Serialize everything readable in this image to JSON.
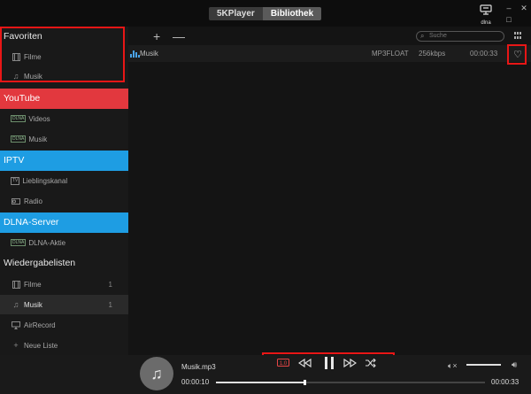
{
  "window": {
    "tabs": [
      "5KPlayer",
      "Bibliothek"
    ],
    "dlna_label": "dlna",
    "controls": [
      "–",
      "□",
      "✕"
    ]
  },
  "sidebar": {
    "favoriten": {
      "title": "Favoriten",
      "items": [
        {
          "label": "Filme",
          "icon": "film-icon"
        },
        {
          "label": "Musik",
          "icon": "music-note-icon"
        }
      ]
    },
    "youtube": {
      "title": "YouTube",
      "items": [
        {
          "label": "Videos",
          "icon": "dlna-icon"
        },
        {
          "label": "Musik",
          "icon": "dlna-icon"
        }
      ]
    },
    "iptv": {
      "title": "IPTV",
      "items": [
        {
          "label": "Lieblingskanal",
          "icon": "tv-icon"
        },
        {
          "label": "Radio",
          "icon": "radio-icon"
        }
      ]
    },
    "dlna_server": {
      "title": "DLNA-Server",
      "items": [
        {
          "label": "DLNA-Aktie",
          "icon": "dlna-icon"
        }
      ]
    },
    "playlists": {
      "title": "Wiedergabelisten",
      "items": [
        {
          "label": "Filme",
          "icon": "film-icon",
          "count": "1"
        },
        {
          "label": "Musik",
          "icon": "music-note-icon",
          "count": "1"
        },
        {
          "label": "AirRecord",
          "icon": "airplay-icon"
        },
        {
          "label": "Neue Liste",
          "icon": "plus-icon"
        }
      ]
    }
  },
  "main": {
    "add_label": "+",
    "remove_label": "—",
    "search_placeholder": "Suche",
    "rows": [
      {
        "name": "Musik",
        "format": "MP3FLOAT",
        "bitrate": "256kbps",
        "duration": "00:00:33"
      }
    ]
  },
  "player": {
    "track": "Musik.mp3",
    "time_current": "00:00:10",
    "time_total": "00:00:33",
    "progress": 0.33,
    "volume": 1.0,
    "speed_label": "1.0"
  },
  "colors": {
    "youtube": "#e2383e",
    "section_blue": "#1e9de3",
    "highlight": "#e81616",
    "accent_bars": "#4aa3e8"
  }
}
